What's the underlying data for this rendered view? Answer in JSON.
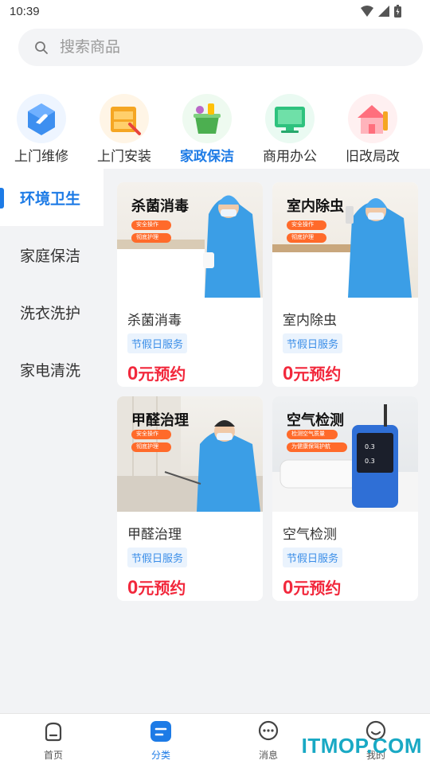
{
  "status_bar": {
    "time": "10:39"
  },
  "search": {
    "placeholder": "搜索商品"
  },
  "categories": [
    {
      "label": "上门维修",
      "icon": "wrench-house-icon",
      "color": "#3d8ff0"
    },
    {
      "label": "上门安装",
      "icon": "toolbox-icon",
      "color": "#f5a623"
    },
    {
      "label": "家政保洁",
      "icon": "cleaning-bucket-icon",
      "color": "#4caf50",
      "active": true
    },
    {
      "label": "商用办公",
      "icon": "monitor-icon",
      "color": "#2ec27e"
    },
    {
      "label": "旧改局改",
      "icon": "house-brush-icon",
      "color": "#ff6f7d"
    }
  ],
  "sidebar": {
    "items": [
      {
        "label": "环境卫生",
        "active": true
      },
      {
        "label": "家庭保洁"
      },
      {
        "label": "洗衣洗护"
      },
      {
        "label": "家电清洗"
      }
    ]
  },
  "products": [
    {
      "image_title": "杀菌消毒",
      "pills": [
        "安全操作",
        "彻底护理"
      ],
      "name": "杀菌消毒",
      "tag": "节假日服务",
      "price_num": "0",
      "price_text": "元预约"
    },
    {
      "image_title": "室内除虫",
      "pills": [
        "安全操作",
        "彻底护理"
      ],
      "name": "室内除虫",
      "tag": "节假日服务",
      "price_num": "0",
      "price_text": "元预约"
    },
    {
      "image_title": "甲醛治理",
      "pills": [
        "安全操作",
        "彻底护理"
      ],
      "name": "甲醛治理",
      "tag": "节假日服务",
      "price_num": "0",
      "price_text": "元预约"
    },
    {
      "image_title": "空气检测",
      "pills": [
        "检测空气质量",
        "为健康保驾护航"
      ],
      "name": "空气检测",
      "tag": "节假日服务",
      "price_num": "0",
      "price_text": "元预约"
    }
  ],
  "tabbar": [
    {
      "label": "首页",
      "icon": "home-icon"
    },
    {
      "label": "分类",
      "icon": "category-icon",
      "active": true
    },
    {
      "label": "消息",
      "icon": "message-icon"
    },
    {
      "label": "我的",
      "icon": "profile-icon"
    }
  ],
  "watermark": "ITMOP.COM",
  "colors": {
    "accent": "#1d7be6",
    "price": "#f2283c",
    "tag_bg": "#eaf3fd"
  }
}
